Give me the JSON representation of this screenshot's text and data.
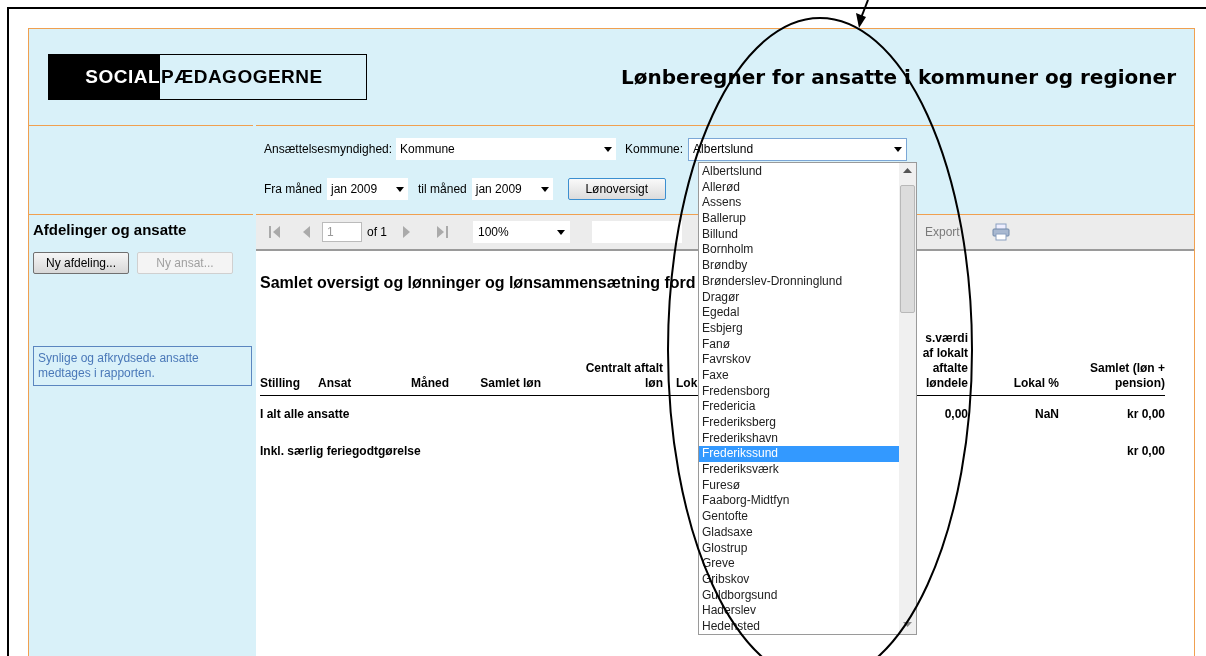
{
  "logo": {
    "dark_part": "SOCIAL",
    "light_part": "PÆDAGOGERNE"
  },
  "title": "Lønberegner for ansatte i kommuner og regioner",
  "filters": {
    "employer_label": "Ansættelsesmyndighed:",
    "employer_value": "Kommune",
    "municipality_label": "Kommune:",
    "municipality_value": "Albertslund",
    "from_label": "Fra måned",
    "from_value": "jan 2009",
    "to_label": "til måned",
    "to_value": "jan 2009",
    "overview_button": "Lønoversigt"
  },
  "sidebar": {
    "heading": "Afdelinger og ansatte",
    "buttons": [
      {
        "label": "Ny afdeling...",
        "disabled": false
      },
      {
        "label": "Ny ansat...",
        "disabled": true
      }
    ],
    "note": "Synlige og afkrydsede ansatte medtages i rapporten."
  },
  "toolbar": {
    "page": "1",
    "page_count": "of 1",
    "zoom": "100%",
    "export": {
      "label": "Export",
      "disabled": true
    }
  },
  "report": {
    "title": "Samlet oversigt og lønninger og lønsammensætning ford",
    "columns": [
      "Stilling",
      "Ansat",
      "Måned",
      "Samlet løn",
      "Centralt aftalt\nløn",
      "Lok",
      "s.værdi\naf lokalt\naftalte\nløndele",
      "Lokal %",
      "Samlet (løn +\npension)"
    ],
    "rows": [
      {
        "cells": [
          "I alt alle ansatte",
          null,
          null,
          null,
          null,
          null,
          "0,00",
          "NaN",
          "kr 0,00"
        ]
      },
      {
        "cells": [
          "Inkl. særlig feriegodtgørelse",
          null,
          null,
          null,
          null,
          null,
          null,
          null,
          "kr 0,00"
        ]
      }
    ]
  },
  "dropdown": {
    "items": [
      {
        "label": "Albertslund",
        "selected": false
      },
      {
        "label": "Allerød",
        "selected": false
      },
      {
        "label": "Assens",
        "selected": false
      },
      {
        "label": "Ballerup",
        "selected": false
      },
      {
        "label": "Billund",
        "selected": false
      },
      {
        "label": "Bornholm",
        "selected": false
      },
      {
        "label": "Brøndby",
        "selected": false
      },
      {
        "label": "Brønderslev-Dronninglund",
        "selected": false
      },
      {
        "label": "Dragør",
        "selected": false
      },
      {
        "label": "Egedal",
        "selected": false
      },
      {
        "label": "Esbjerg",
        "selected": false
      },
      {
        "label": "Fanø",
        "selected": false
      },
      {
        "label": "Favrskov",
        "selected": false
      },
      {
        "label": "Faxe",
        "selected": false
      },
      {
        "label": "Fredensborg",
        "selected": false
      },
      {
        "label": "Fredericia",
        "selected": false
      },
      {
        "label": "Frederiksberg",
        "selected": false
      },
      {
        "label": "Frederikshavn",
        "selected": false
      },
      {
        "label": "Frederikssund",
        "selected": true
      },
      {
        "label": "Frederiksværk",
        "selected": false
      },
      {
        "label": "Furesø",
        "selected": false
      },
      {
        "label": "Faaborg-Midtfyn",
        "selected": false
      },
      {
        "label": "Gentofte",
        "selected": false
      },
      {
        "label": "Gladsaxe",
        "selected": false
      },
      {
        "label": "Glostrup",
        "selected": false
      },
      {
        "label": "Greve",
        "selected": false
      },
      {
        "label": "Gribskov",
        "selected": false
      },
      {
        "label": "Guldborgsund",
        "selected": false
      },
      {
        "label": "Haderslev",
        "selected": false
      },
      {
        "label": "Hedensted",
        "selected": false
      }
    ]
  }
}
